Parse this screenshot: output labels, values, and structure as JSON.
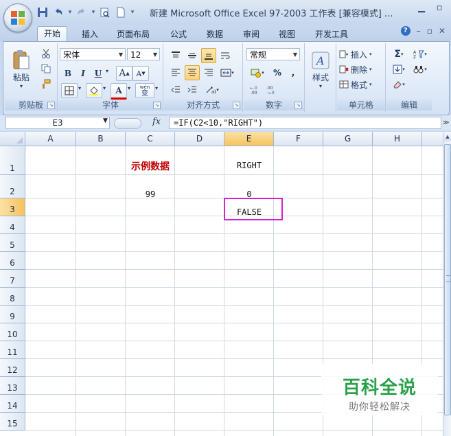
{
  "title_bar": {
    "title": "新建 Microsoft Office Excel 97-2003 工作表 [兼容模式] ...",
    "quick_access": [
      "save-icon",
      "undo-icon",
      "redo-icon",
      "print-preview-icon",
      "new-document-icon",
      "customize-icon"
    ]
  },
  "tabs": [
    "开始",
    "插入",
    "页面布局",
    "公式",
    "数据",
    "审阅",
    "视图",
    "开发工具"
  ],
  "active_tab": "开始",
  "ribbon": {
    "clipboard": {
      "label": "剪贴板",
      "paste": "粘贴"
    },
    "font": {
      "label": "字体",
      "font_name": "宋体",
      "font_size": "12",
      "bold": "B",
      "italic": "I",
      "underline": "U",
      "grow": "A",
      "shrink": "A",
      "font_color_letter": "A",
      "phonetic": "wén",
      "phonetic_char": "变"
    },
    "alignment": {
      "label": "对齐方式"
    },
    "number": {
      "label": "数字",
      "format": "常规",
      "percent": "%",
      "comma": ","
    },
    "styles": {
      "label": "样式"
    },
    "cells": {
      "label": "单元格",
      "insert": "插入",
      "delete": "删除",
      "format": "格式"
    },
    "editing": {
      "label": "编辑"
    }
  },
  "formula_bar": {
    "name_box": "E3",
    "fx": "fx",
    "formula": "=IF(C2<10,\"RIGHT\")"
  },
  "grid": {
    "columns": [
      "A",
      "B",
      "C",
      "D",
      "E",
      "F",
      "G",
      "H"
    ],
    "rows": [
      "1",
      "2",
      "3",
      "4",
      "5",
      "6",
      "7",
      "8",
      "9",
      "10",
      "11",
      "12",
      "13",
      "14",
      "15"
    ],
    "selected_cell": "E3",
    "cells": {
      "C1": "示例数据",
      "E1": "RIGHT",
      "C2": "99",
      "E2": "0",
      "E3": "FALSE"
    }
  },
  "watermark": {
    "title": "百科全说",
    "subtitle": "助你轻松解决"
  }
}
